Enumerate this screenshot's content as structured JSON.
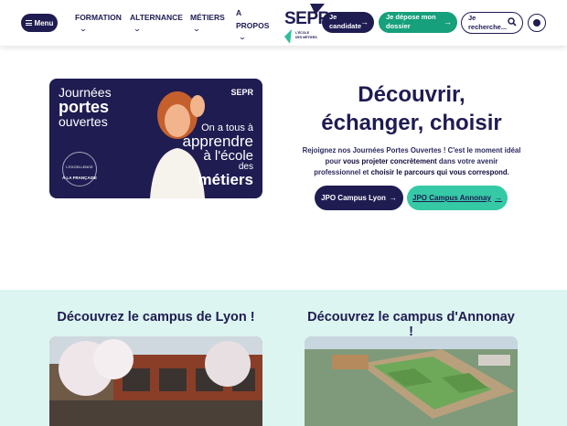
{
  "header": {
    "menu_label": "Menu",
    "nav": [
      {
        "label": "FORMATION",
        "chevron": "⌄"
      },
      {
        "label": "ALTERNANCE",
        "chevron": "⌄"
      },
      {
        "label": "MÉTIERS",
        "chevron": "⌄"
      },
      {
        "label_line1": "A",
        "label_line2": "PROPOS",
        "chevron": "⌄"
      }
    ],
    "logo": {
      "text": "SEPR",
      "subtitle_line1": "L'ÉCOLE",
      "subtitle_line2": "DES MÉTIERS"
    },
    "cta_candidate": {
      "line1": "Je",
      "line2": "candidate",
      "arrow": "→"
    },
    "cta_dossier": {
      "line1": "Je dépose mon",
      "line2": "dossier",
      "arrow": "→"
    },
    "search": {
      "line1": "Je",
      "line2": "recherche..."
    }
  },
  "hero": {
    "image": {
      "line1": "Journées",
      "line2": "portes",
      "line3": "ouvertes",
      "badge": "L'EXCELLENCE",
      "badge_bottom": "À LA FRANÇAISE",
      "brand": "SEPR",
      "tag1": "On a tous à",
      "tag2": "apprendre",
      "tag3": "à l'école",
      "tag4": "des",
      "tag5": "métiers"
    },
    "title_line1": "Découvrir,",
    "title_line2": "échanger, choisir",
    "desc_part1": "Rejoignez nos Journées Portes Ouvertes ! C'est le moment idéal pour ",
    "desc_strong1": "vous projeter concrètement",
    "desc_part2": " dans votre avenir professionnel et ",
    "desc_strong2": "choisir le parcours qui vous correspond",
    "desc_part3": ".",
    "btn_lyon": "JPO Campus Lyon",
    "btn_annonay": "JPO Campus Annonay",
    "arrow": "→"
  },
  "campus": {
    "lyon_title": "Découvrez le campus de Lyon !",
    "annonay_title": "Découvrez le campus d'Annonay !"
  },
  "colors": {
    "navy": "#1f1c52",
    "green": "#16a07b",
    "mint": "#35c9a6",
    "section_bg": "#dcf5f0"
  }
}
